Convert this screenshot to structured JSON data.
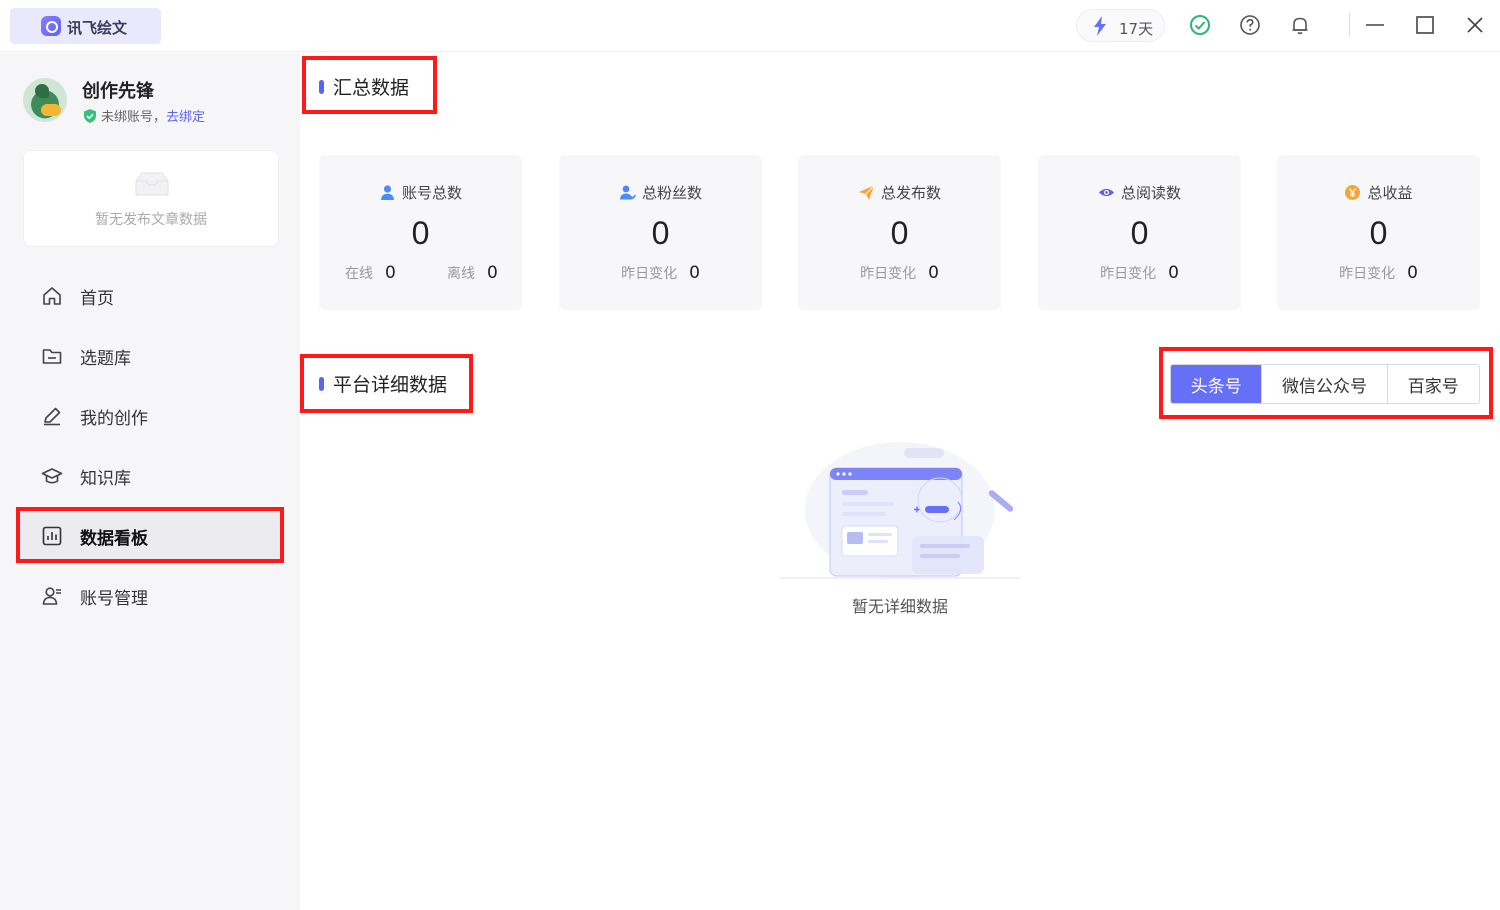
{
  "app": {
    "name": "讯飞绘文"
  },
  "titlebar": {
    "trial_days": "17天"
  },
  "user": {
    "name": "创作先锋",
    "status": "未绑账号，",
    "bind_link": "去绑定"
  },
  "sidebar_card": {
    "empty_text": "暂无发布文章数据"
  },
  "nav": [
    {
      "label": "首页",
      "icon": "home-icon"
    },
    {
      "label": "选题库",
      "icon": "folder-icon"
    },
    {
      "label": "我的创作",
      "icon": "pen-icon"
    },
    {
      "label": "知识库",
      "icon": "graduation-cap-icon"
    },
    {
      "label": "数据看板",
      "icon": "bar-chart-icon",
      "active": true
    },
    {
      "label": "账号管理",
      "icon": "user-settings-icon"
    }
  ],
  "summary": {
    "title": "汇总数据",
    "cards": [
      {
        "label": "账号总数",
        "value": "0",
        "foot_left_label": "在线",
        "foot_left_value": "0",
        "foot_right_label": "离线",
        "foot_right_value": "0",
        "icon": "user-icon"
      },
      {
        "label": "总粉丝数",
        "value": "0",
        "foot_label": "昨日变化",
        "foot_value": "0",
        "icon": "fans-icon"
      },
      {
        "label": "总发布数",
        "value": "0",
        "foot_label": "昨日变化",
        "foot_value": "0",
        "icon": "send-icon"
      },
      {
        "label": "总阅读数",
        "value": "0",
        "foot_label": "昨日变化",
        "foot_value": "0",
        "icon": "eye-icon"
      },
      {
        "label": "总收益",
        "value": "0",
        "foot_label": "昨日变化",
        "foot_value": "0",
        "icon": "yen-coin-icon"
      }
    ]
  },
  "platform": {
    "title": "平台详细数据",
    "tabs": [
      {
        "label": "头条号",
        "active": true
      },
      {
        "label": "微信公众号",
        "active": false
      },
      {
        "label": "百家号",
        "active": false
      }
    ],
    "empty_text": "暂无详细数据"
  },
  "colors": {
    "accent": "#5b63f5",
    "tab_active": "#6670f7",
    "highlight": "#ff1a1a",
    "sidebar_bg": "#f6f6f8"
  }
}
